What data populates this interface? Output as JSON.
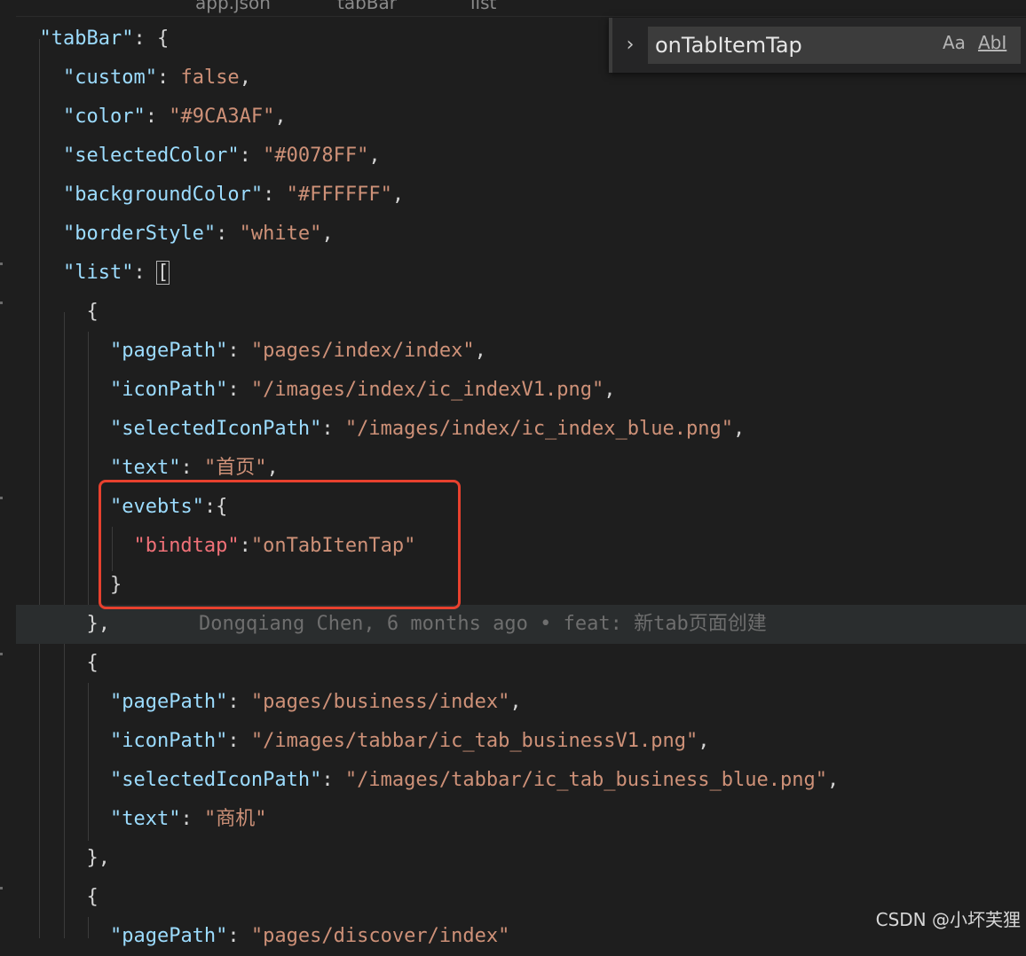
{
  "breadcrumb": {
    "items": [
      "app.json",
      "tabBar",
      "list"
    ]
  },
  "find": {
    "query": "onTabItemTap",
    "match_case_label": "Aa",
    "whole_word_label": "AbI"
  },
  "code": {
    "tabBar_key": "\"tabBar\"",
    "custom_key": "\"custom\"",
    "custom_val": "false",
    "color_key": "\"color\"",
    "color_val": "\"#9CA3AF\"",
    "selectedColor_key": "\"selectedColor\"",
    "selectedColor_val": "\"#0078FF\"",
    "backgroundColor_key": "\"backgroundColor\"",
    "backgroundColor_val": "\"#FFFFFF\"",
    "borderStyle_key": "\"borderStyle\"",
    "borderStyle_val": "\"white\"",
    "list_key": "\"list\"",
    "item1": {
      "pagePath_key": "\"pagePath\"",
      "pagePath_val": "\"pages/index/index\"",
      "iconPath_key": "\"iconPath\"",
      "iconPath_val": "\"/images/index/ic_indexV1.png\"",
      "selectedIconPath_key": "\"selectedIconPath\"",
      "selectedIconPath_val": "\"/images/index/ic_index_blue.png\"",
      "text_key": "\"text\"",
      "text_val": "\"首页\"",
      "evebts_key": "\"evebts\"",
      "bindtap_key": "\"bindtap\"",
      "bindtap_val": "\"onTabItenTap\""
    },
    "blame": "Dongqiang Chen, 6 months ago • feat: 新tab页面创建",
    "item2": {
      "pagePath_key": "\"pagePath\"",
      "pagePath_val": "\"pages/business/index\"",
      "iconPath_key": "\"iconPath\"",
      "iconPath_val": "\"/images/tabbar/ic_tab_businessV1.png\"",
      "selectedIconPath_key": "\"selectedIconPath\"",
      "selectedIconPath_val": "\"/images/tabbar/ic_tab_business_blue.png\"",
      "text_key": "\"text\"",
      "text_val": "\"商机\""
    },
    "item3": {
      "pagePath_key": "\"pagePath\"",
      "pagePath_val": "\"pages/discover/index\""
    }
  },
  "watermark": "CSDN @小坏芙狸"
}
